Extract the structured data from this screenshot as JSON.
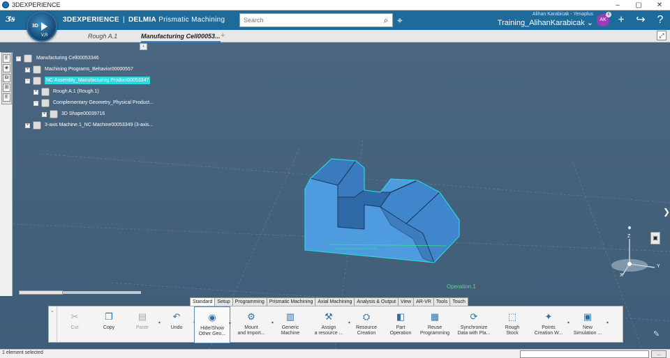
{
  "window": {
    "title": "3DEXPERIENCE",
    "controls": [
      "–",
      "▢",
      "✕"
    ]
  },
  "header": {
    "compass": {
      "top": "3D",
      "bottom": "V,R"
    },
    "brand_main": "3DEXPERIENCE",
    "brand_sep": "|",
    "brand_product": "DELMIA",
    "brand_app": "Prismatic Machining",
    "search_placeholder": "Search",
    "user_line": "Alihan Karabicak - Yenaplus",
    "space": "Training_AlihanKarabicak",
    "avatar_initials": "AK",
    "avatar_badge": "6",
    "icons": [
      "tag-icon",
      "plus-icon",
      "share-icon",
      "help-icon"
    ]
  },
  "tabs": {
    "items": [
      {
        "label": "Rough A.1"
      },
      {
        "label": "Manufacturing Cell00053..."
      }
    ],
    "add": "+"
  },
  "tree": {
    "nodes": [
      {
        "label": "Manufacturing Cell00053346",
        "level": 0
      },
      {
        "label": "Machining Programs_Behavior00000557",
        "level": 1
      },
      {
        "label": "NC Assembly_Manufacturing Product00053347",
        "level": 1,
        "selected": true
      },
      {
        "label": "Rough A.1 (Rough.1)",
        "level": 2
      },
      {
        "label": "Complementary Geometry_Physical Product...",
        "level": 2
      },
      {
        "label": "3D Shape00039716",
        "level": 3
      },
      {
        "label": "3-axis Machine.1_NC Machine00053349 (3-axis...",
        "level": 1
      }
    ]
  },
  "left_tools": [
    "E",
    "◈",
    "₪",
    "⊞",
    "E"
  ],
  "viewport": {
    "operation_label": "Operation.1",
    "axis": {
      "z": "Z",
      "y": "Y",
      "x": "X"
    },
    "accent": "#2bd7e0",
    "part_color": "#4a90d9"
  },
  "section_tabs": [
    {
      "label": "Standard",
      "active": true
    },
    {
      "label": "Setup",
      "active": false
    },
    {
      "label": "Programming",
      "active": false
    },
    {
      "label": "Prismatic Machining",
      "active": false
    },
    {
      "label": "Axial Machining",
      "active": false
    },
    {
      "label": "Analysis & Output",
      "active": false
    },
    {
      "label": "View",
      "active": false
    },
    {
      "label": "AR-VR",
      "active": false
    },
    {
      "label": "Tools",
      "active": false
    },
    {
      "label": "Touch",
      "active": false
    }
  ],
  "commands": [
    {
      "line1": "Cut",
      "line2": "",
      "icon": "scissors-icon",
      "glyph": "✂",
      "dim": true,
      "dd": false
    },
    {
      "line1": "Copy",
      "line2": "",
      "icon": "copy-icon",
      "glyph": "❐",
      "dim": false,
      "dd": false
    },
    {
      "line1": "Paste",
      "line2": "",
      "icon": "paste-icon",
      "glyph": "▤",
      "dim": true,
      "dd": true
    },
    {
      "line1": "Undo",
      "line2": "",
      "icon": "undo-icon",
      "glyph": "↶",
      "dim": false,
      "dd": true
    },
    {
      "line1": "Hide/Show",
      "line2": "Other Geo...",
      "icon": "hide-show-icon",
      "glyph": "◉",
      "dim": false,
      "dd": true,
      "selected": true
    },
    {
      "line1": "Mount",
      "line2": "and Import...",
      "icon": "mount-icon",
      "glyph": "⚙",
      "dim": false,
      "dd": true
    },
    {
      "line1": "Generic",
      "line2": "Machine",
      "icon": "generic-machine-icon",
      "glyph": "▥",
      "dim": false,
      "dd": false
    },
    {
      "line1": "Assign",
      "line2": "a resource ...",
      "icon": "assign-resource-icon",
      "glyph": "⚒",
      "dim": false,
      "dd": true
    },
    {
      "line1": "Resource",
      "line2": "Creation",
      "icon": "resource-creation-icon",
      "glyph": "⛭",
      "dim": false,
      "dd": false
    },
    {
      "line1": "Part",
      "line2": "Operation",
      "icon": "part-operation-icon",
      "glyph": "◧",
      "dim": false,
      "dd": false
    },
    {
      "line1": "Reuse",
      "line2": "Programming",
      "icon": "reuse-programming-icon",
      "glyph": "▦",
      "dim": false,
      "dd": false
    },
    {
      "line1": "Synchronize",
      "line2": "Data with Pla...",
      "icon": "synchronize-icon",
      "glyph": "⟳",
      "dim": false,
      "dd": false
    },
    {
      "line1": "Rough",
      "line2": "Stock",
      "icon": "rough-stock-icon",
      "glyph": "⬚",
      "dim": false,
      "dd": false
    },
    {
      "line1": "Points",
      "line2": "Creation W...",
      "icon": "points-creation-icon",
      "glyph": "✦",
      "dim": false,
      "dd": true
    },
    {
      "line1": "New",
      "line2": "Simulation ...",
      "icon": "new-simulation-icon",
      "glyph": "▣",
      "dim": false,
      "dd": true
    }
  ],
  "status": {
    "text": "1 element selected",
    "input_value": "",
    "button": "..."
  }
}
